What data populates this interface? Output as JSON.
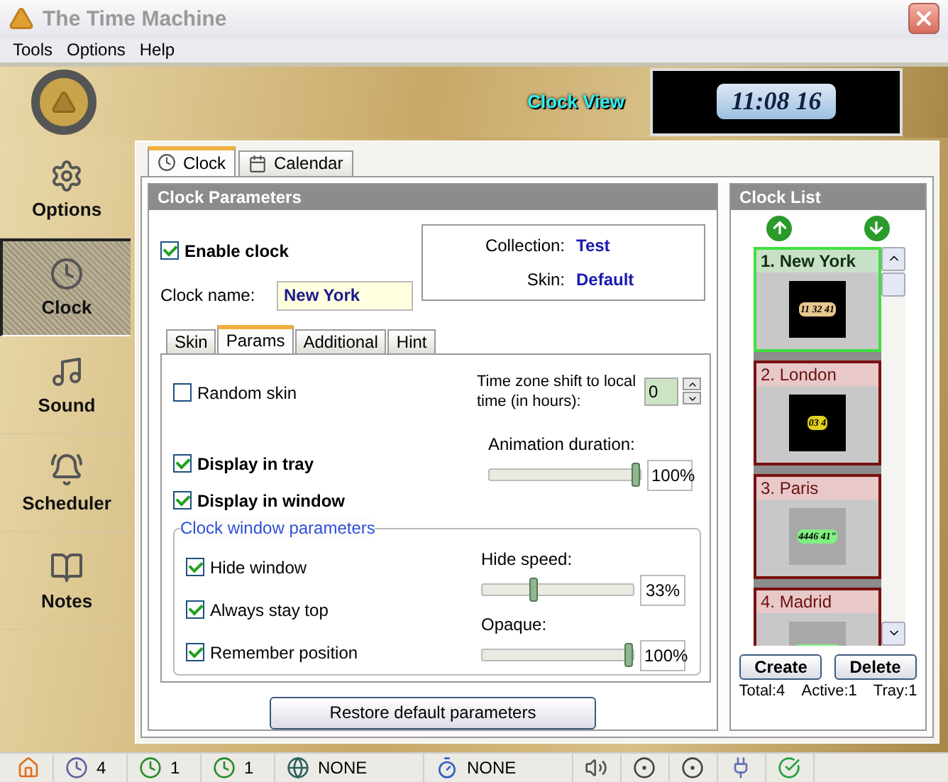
{
  "window": {
    "title": "The Time Machine"
  },
  "menu": [
    "Tools",
    "Options",
    "Help"
  ],
  "header": {
    "label": "Clock View",
    "time": "11:08 16"
  },
  "sidebar": [
    {
      "label": "Options",
      "kind": "options",
      "selected": false
    },
    {
      "label": "Clock",
      "kind": "clock",
      "selected": true
    },
    {
      "label": "Sound",
      "kind": "sound",
      "selected": false
    },
    {
      "label": "Scheduler",
      "kind": "scheduler",
      "selected": false
    },
    {
      "label": "Notes",
      "kind": "notes",
      "selected": false
    }
  ],
  "tabs": [
    {
      "label": "Clock",
      "kind": "clock",
      "selected": true
    },
    {
      "label": "Calendar",
      "kind": "calendar",
      "selected": false
    }
  ],
  "clock_parameters": {
    "title": "Clock Parameters",
    "enable_clock": {
      "label": "Enable clock",
      "checked": true
    },
    "clock_name": {
      "label": "Clock name:",
      "value": "New York"
    },
    "collection": {
      "label": "Collection:",
      "value": "Test"
    },
    "skin": {
      "label": "Skin:",
      "value": "Default"
    },
    "subtabs": [
      {
        "label": "Skin",
        "selected": false
      },
      {
        "label": "Params",
        "selected": true
      },
      {
        "label": "Additional",
        "selected": false
      },
      {
        "label": "Hint",
        "selected": false
      }
    ],
    "random_skin": {
      "label": "Random skin",
      "checked": false
    },
    "timezone": {
      "label": "Time zone shift to local time (in hours):",
      "value": "0"
    },
    "display_checks": [
      {
        "label": "Display in tray",
        "checked": true
      },
      {
        "label": "Display in window",
        "checked": true
      }
    ],
    "animation": {
      "label": "Animation duration:",
      "level": 1,
      "reading": "100%"
    },
    "window_group": {
      "title": "Clock window parameters",
      "checks": [
        {
          "label": "Hide window",
          "checked": true
        },
        {
          "label": "Always stay top",
          "checked": true
        },
        {
          "label": "Remember position",
          "checked": true
        }
      ],
      "sliders": [
        {
          "label": "Hide speed:",
          "level": 0.33,
          "reading": "33%"
        },
        {
          "label": "Opaque:",
          "level": 1,
          "reading": "100%"
        }
      ]
    },
    "restore_button": "Restore default parameters"
  },
  "clock_list": {
    "title": "Clock List",
    "items": [
      {
        "name": "1. New York",
        "selected": true,
        "kind": "tan",
        "preview": "11 32 41"
      },
      {
        "name": "2. London",
        "selected": false,
        "kind": "yellow",
        "preview": "03 4"
      },
      {
        "name": "3. Paris",
        "selected": false,
        "kind": "green",
        "preview": "4446 41\""
      },
      {
        "name": "4. Madrid",
        "selected": false,
        "kind": "green"
      }
    ],
    "buttons": [
      "Create",
      "Delete"
    ],
    "totals": [
      "Total:4",
      "Active:1",
      "Tray:1"
    ]
  },
  "status_bar": [
    {
      "kind": "home"
    },
    {
      "kind": "clocks",
      "text": "4"
    },
    {
      "kind": "active",
      "text": "1"
    },
    {
      "kind": "tray",
      "text": "1"
    },
    {
      "kind": "globe",
      "text": "NONE"
    },
    {
      "kind": "timer",
      "text": "NONE"
    },
    {
      "kind": "speaker"
    },
    {
      "kind": "record"
    },
    {
      "kind": "record"
    },
    {
      "kind": "plug"
    },
    {
      "kind": "check"
    }
  ]
}
